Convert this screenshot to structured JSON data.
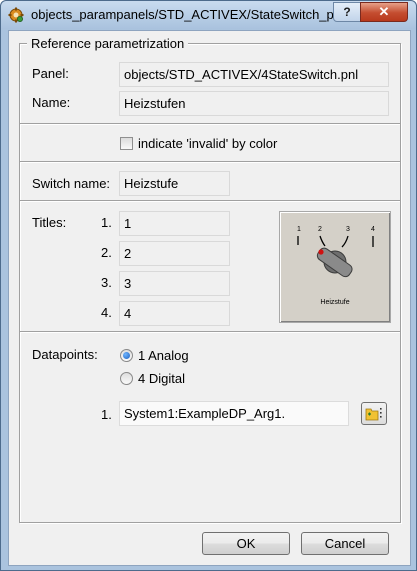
{
  "window": {
    "title": "objects_parampanels/STD_ACTIVEX/StateSwitch_para.p...",
    "help_label": "?",
    "close_label": "✕"
  },
  "group": {
    "title": "Reference parametrization",
    "panel_label": "Panel:",
    "panel_value": "objects/STD_ACTIVEX/4StateSwitch.pnl",
    "name_label": "Name:",
    "name_value": "Heizstufen"
  },
  "invalid_checkbox": {
    "label": "indicate 'invalid' by color",
    "checked": false
  },
  "switch": {
    "label": "Switch name:",
    "value": "Heizstufe"
  },
  "titles": {
    "label": "Titles:",
    "items": [
      {
        "num": "1.",
        "value": "1"
      },
      {
        "num": "2.",
        "value": "2"
      },
      {
        "num": "3.",
        "value": "3"
      },
      {
        "num": "4.",
        "value": "4"
      }
    ]
  },
  "preview": {
    "scale_labels": [
      "1",
      "2",
      "3",
      "4"
    ],
    "caption": "Heizstufe"
  },
  "datapoints": {
    "label": "Datapoints:",
    "options": [
      {
        "label": "1 Analog",
        "selected": true
      },
      {
        "label": "4 Digital",
        "selected": false
      }
    ],
    "row_num": "1.",
    "row_value": "System1:ExampleDP_Arg1."
  },
  "buttons": {
    "ok": "OK",
    "cancel": "Cancel"
  },
  "colors": {
    "accent": "#1b5fbf",
    "close": "#c44d30",
    "frame": "#aac3de"
  }
}
